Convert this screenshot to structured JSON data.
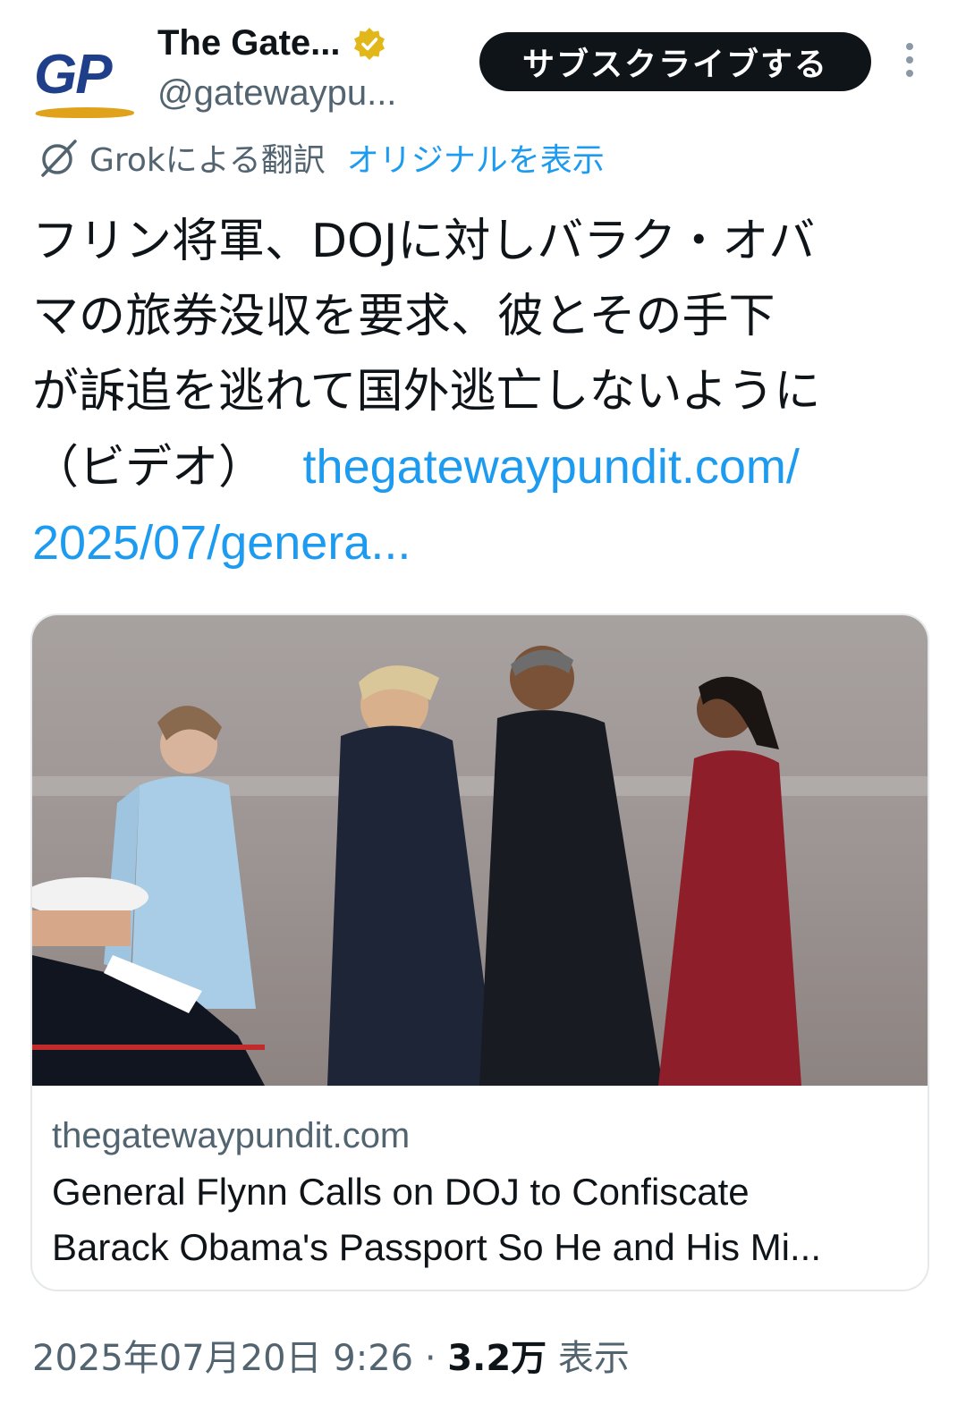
{
  "header": {
    "avatar_text": "GP",
    "name": "The Gate...",
    "handle": "@gatewaypu...",
    "subscribe_label": "サブスクライブする"
  },
  "translation": {
    "label": "Grokによる翻訳",
    "original_link": "オリジナルを表示"
  },
  "tweet": {
    "line1": "フリン将軍、DOJに対しバラク・オバ",
    "line2": "マの旅券没収を要求、彼とその手下",
    "line3": "が訴追を逃れて国外逃亡しないように",
    "line4_text": "（ビデオ）",
    "link_part1": "thegatewaypundit.com/",
    "link_part2": "2025/07/genera..."
  },
  "card": {
    "domain": "thegatewaypundit.com",
    "title_line1": "General Flynn Calls on DOJ to Confiscate",
    "title_line2": "Barack Obama's Passport So He and His Mi..."
  },
  "footer": {
    "timestamp": "2025年07月20日 9:26",
    "separator": "·",
    "views_count": "3.2万",
    "views_label": "表示"
  },
  "colors": {
    "accent": "#1d9bf0",
    "text": "#0f1419",
    "muted": "#536471",
    "verified": "#e2b719"
  }
}
